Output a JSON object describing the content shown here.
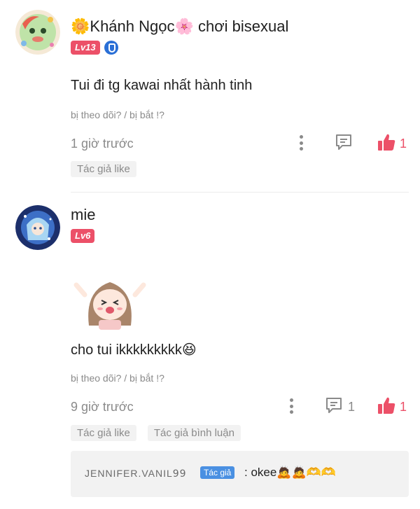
{
  "comments": [
    {
      "name": "🌼Khánh Ngọc🌸 chơi bisexual",
      "level": "Lv13",
      "text": "Tui đi tg kawai nhất hành tinh",
      "follow_line": "bị theo dõi? / bị bắt !?",
      "time": "1 giờ trước",
      "reply_count": "",
      "like_count": "1",
      "tags": [
        "Tác giả like"
      ]
    },
    {
      "name": "mie",
      "level": "Lv6",
      "text": "cho tui ikkkkkkkkk😆",
      "follow_line": "bị theo dõi? / bị bắt !?",
      "time": "9 giờ trước",
      "reply_count": "1",
      "like_count": "1",
      "tags": [
        "Tác giả like",
        "Tác giả bình luận"
      ],
      "reply": {
        "author": "JENNIFER.VANIL𝟫𝟫",
        "author_tag": "Tác giả",
        "text": ": okee🙇🙇🫶🫶"
      }
    }
  ],
  "colors": {
    "accent": "#ec5068",
    "muted": "#8a8a8a",
    "tag_blue": "#4a90e2"
  },
  "icons": [
    "more-icon",
    "comment-icon",
    "like-icon",
    "verified-icon"
  ]
}
